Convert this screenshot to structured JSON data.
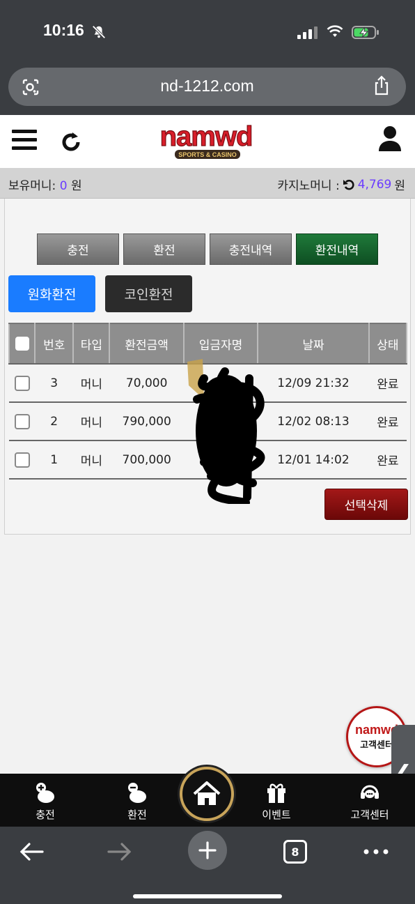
{
  "status_bar": {
    "time": "10:16"
  },
  "browser": {
    "url": "nd-1212.com",
    "tabs_count": "8"
  },
  "site": {
    "logo_text": "NAMWD",
    "logo_sub": "SPORTS & CASINO"
  },
  "balance": {
    "holding_label": "보유머니:",
    "holding_value": "0",
    "holding_unit": "원",
    "casino_label": "카지노머니 :",
    "casino_value": "4,769",
    "casino_unit": "원"
  },
  "tabs": [
    "충전",
    "환전",
    "충전내역",
    "환전내역"
  ],
  "subtabs": [
    "원화환전",
    "코인환전"
  ],
  "table": {
    "headers": [
      "번호",
      "타입",
      "환전금액",
      "입금자명",
      "날짜",
      "상태"
    ],
    "rows": [
      {
        "no": "3",
        "type": "머니",
        "amount": "70,000",
        "name": "",
        "date": "12/09 21:32",
        "status": "완료"
      },
      {
        "no": "2",
        "type": "머니",
        "amount": "790,000",
        "name": "",
        "date": "12/02 08:13",
        "status": "완료"
      },
      {
        "no": "1",
        "type": "머니",
        "amount": "700,000",
        "name": "",
        "date": "12/01 14:02",
        "status": "완료"
      }
    ]
  },
  "delete_button": "선택삭제",
  "cs_badge": {
    "brand": "namwd",
    "label": "고객센터"
  },
  "bottom_nav": [
    {
      "label": "충전",
      "icon": "piggy-plus-icon"
    },
    {
      "label": "환전",
      "icon": "piggy-minus-icon"
    },
    {
      "label": "",
      "icon": "home-icon"
    },
    {
      "label": "이벤트",
      "icon": "gift-icon"
    },
    {
      "label": "고객센터",
      "icon": "headset-icon"
    }
  ],
  "colors": {
    "accent_blue": "#1a7cff",
    "active_green": "#0e4f22",
    "delete_red": "#8a0f0f",
    "money_purple": "#6b3cff"
  }
}
